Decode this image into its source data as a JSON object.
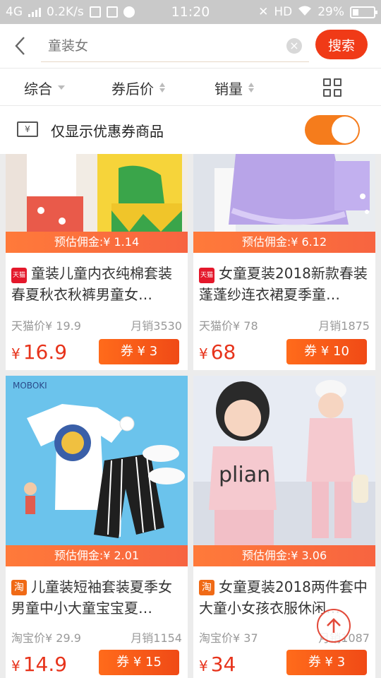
{
  "status_bar": {
    "network": "4G",
    "speed": "0.2K/s",
    "time": "11:20",
    "hd": "HD",
    "battery": "29%"
  },
  "search": {
    "placeholder": "童装女",
    "button_label": "搜索"
  },
  "filters": [
    {
      "label": "综合"
    },
    {
      "label": "券后价"
    },
    {
      "label": "销量"
    }
  ],
  "coupon_toggle": {
    "label": "仅显示优惠券商品",
    "ticket_icon_text": "¥",
    "enabled": true
  },
  "products": [
    {
      "commission": "预估佣金:¥ 1.14",
      "platform": "tmall",
      "platform_badge": "天猫",
      "title": "童装儿童内衣纯棉套装春夏秋衣秋裤男童女…",
      "original_price_label": "天猫价¥  19.9",
      "monthly_sales": "月销3530",
      "price_symbol": "¥",
      "price": "16.9",
      "coupon": "券 ¥  3"
    },
    {
      "commission": "预估佣金:¥ 6.12",
      "platform": "tmall",
      "platform_badge": "天猫",
      "title": "女童夏装2018新款春装蓬蓬纱连衣裙夏季童…",
      "original_price_label": "天猫价¥  78",
      "monthly_sales": "月销1875",
      "price_symbol": "¥",
      "price": "68",
      "coupon": "券 ¥  10"
    },
    {
      "commission": "预估佣金:¥ 2.01",
      "platform": "taobao",
      "platform_badge": "淘",
      "title": "儿童装短袖套装夏季女男童中小大童宝宝夏…",
      "original_price_label": "淘宝价¥  29.9",
      "monthly_sales": "月销1154",
      "price_symbol": "¥",
      "price": "14.9",
      "coupon": "券 ¥  15",
      "image_brand": "MOBOKI"
    },
    {
      "commission": "预估佣金:¥ 3.06",
      "platform": "taobao",
      "platform_badge": "淘",
      "title": "女童夏装2018两件套中大童小女孩衣服休闲…",
      "original_price_label": "淘宝价¥  37",
      "monthly_sales": "月销1087",
      "price_symbol": "¥",
      "price": "34",
      "coupon": "券 ¥  3",
      "image_text": "plian"
    }
  ],
  "colors": {
    "accent": "#f03a17",
    "toggle": "#f57c1c",
    "price": "#e7331b"
  }
}
